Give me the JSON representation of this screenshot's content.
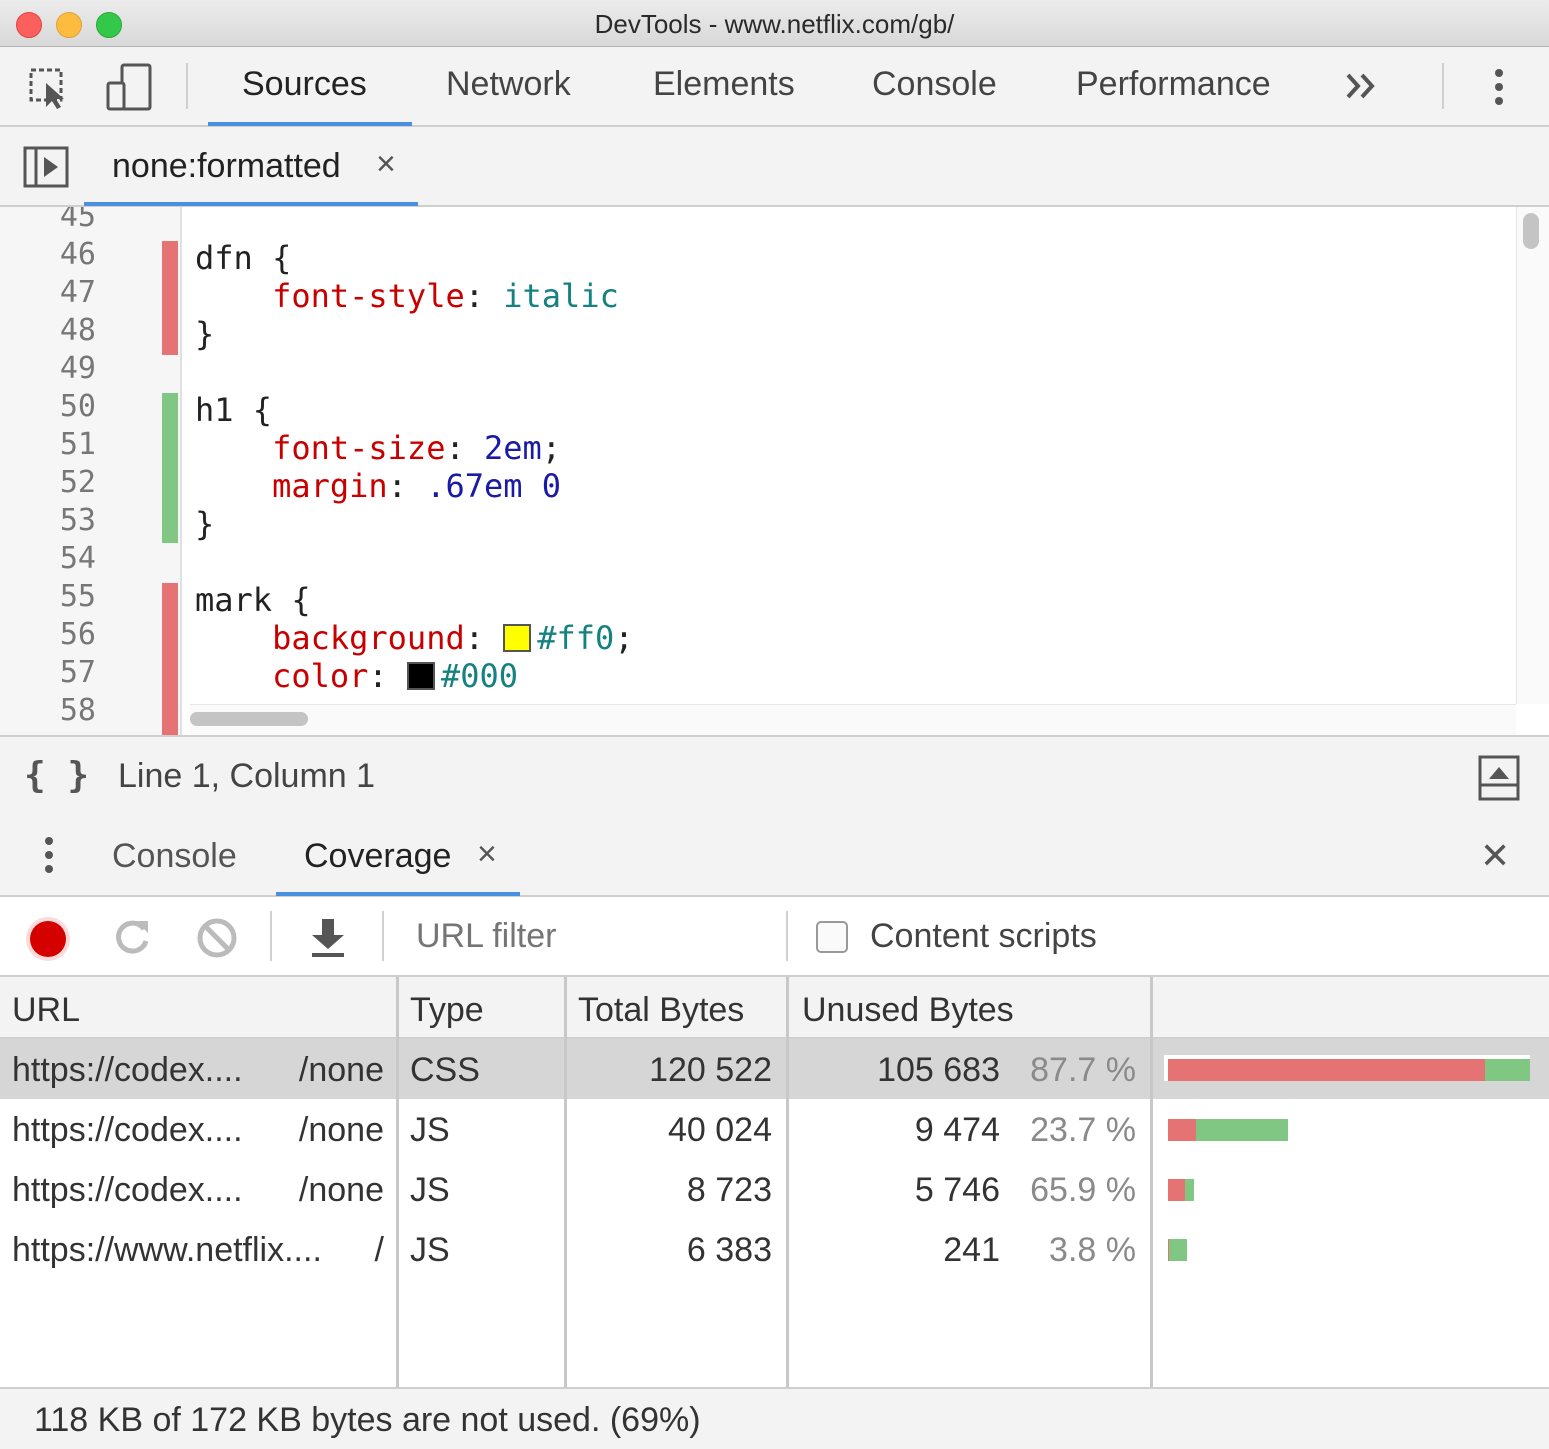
{
  "window": {
    "title": "DevTools - www.netflix.com/gb/",
    "traffic_colors": [
      "#fc605c",
      "#fdbc40",
      "#34c84a"
    ]
  },
  "main_tabs": [
    {
      "label": "Sources",
      "active": true
    },
    {
      "label": "Network",
      "active": false
    },
    {
      "label": "Elements",
      "active": false
    },
    {
      "label": "Console",
      "active": false
    },
    {
      "label": "Performance",
      "active": false
    }
  ],
  "more_tabs_icon": "chevron-double-right",
  "file_tab": {
    "label": "none:formatted",
    "close": "×"
  },
  "editor": {
    "line_numbers": [
      "45",
      "46",
      "47",
      "48",
      "49",
      "50",
      "51",
      "52",
      "53",
      "54",
      "55",
      "56",
      "57",
      "58"
    ],
    "code": {
      "l46": "dfn {",
      "l47_prop": "font-style",
      "l47_val": "italic",
      "l48": "}",
      "l50": "h1 {",
      "l51_prop": "font-size",
      "l51_val": "2em",
      "l52_prop": "margin",
      "l52_val": ".67em 0",
      "l53": "}",
      "l55": "mark {",
      "l56_prop": "background",
      "l56_val": "#ff0",
      "l57_prop": "color",
      "l57_val": "#000"
    },
    "unused_color": "#e57373",
    "used_color": "#81c784"
  },
  "status": {
    "format_icon": "{ }",
    "position": "Line 1, Column 1"
  },
  "drawer": {
    "tabs": [
      {
        "label": "Console",
        "active": false
      },
      {
        "label": "Coverage",
        "active": true,
        "close": "×"
      }
    ],
    "close": "✕"
  },
  "coverage_toolbar": {
    "url_filter_placeholder": "URL filter",
    "content_scripts_label": "Content scripts",
    "record_color": "#d50000"
  },
  "table": {
    "headers": [
      "URL",
      "Type",
      "Total Bytes",
      "Unused Bytes"
    ],
    "rows": [
      {
        "url": "https://codex....",
        "url_tail": "/none",
        "type": "CSS",
        "total": "120 522",
        "unused": "105 683",
        "pct": "87.7 %",
        "unused_frac": 0.877,
        "size_frac": 1.0
      },
      {
        "url": "https://codex....",
        "url_tail": "/none",
        "type": "JS",
        "total": "40 024",
        "unused": "9 474",
        "pct": "23.7 %",
        "unused_frac": 0.237,
        "size_frac": 0.332
      },
      {
        "url": "https://codex....",
        "url_tail": "/none",
        "type": "JS",
        "total": "8 723",
        "unused": "5 746",
        "pct": "65.9 %",
        "unused_frac": 0.659,
        "size_frac": 0.072
      },
      {
        "url": "https://www.netflix....",
        "url_tail": "/",
        "type": "JS",
        "total": "6 383",
        "unused": "241",
        "pct": "3.8 %",
        "unused_frac": 0.038,
        "size_frac": 0.053
      }
    ]
  },
  "footer": {
    "summary": "118 KB of 172 KB bytes are not used. (69%)"
  }
}
